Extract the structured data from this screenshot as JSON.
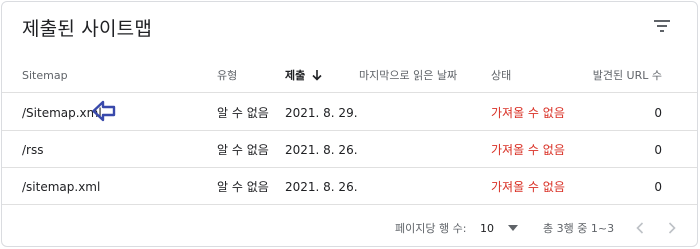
{
  "card": {
    "title": "제출된 사이트맵"
  },
  "icons": {
    "filter": "filter-icon",
    "sort": "arrow-down-icon",
    "annotation": "left-arrow-annotation-icon",
    "page_size_dropdown": "triangle-down-icon",
    "prev": "chevron-left-icon",
    "next": "chevron-right-icon"
  },
  "colors": {
    "error": "#d93025",
    "annotation": "#3949ab",
    "border": "#e0e0e0"
  },
  "table": {
    "headers": {
      "sitemap": "Sitemap",
      "type": "유형",
      "submitted": "제출",
      "last_read": "마지막으로 읽은 날짜",
      "status": "상태",
      "discovered_urls": "발견된 URL 수"
    },
    "rows": [
      {
        "sitemap": "/Sitemap.xml",
        "type": "알 수 없음",
        "submitted": "2021. 8. 29.",
        "last_read": "",
        "status": "가져올 수 없음",
        "discovered_urls": "0"
      },
      {
        "sitemap": "/rss",
        "type": "알 수 없음",
        "submitted": "2021. 8. 26.",
        "last_read": "",
        "status": "가져올 수 없음",
        "discovered_urls": "0"
      },
      {
        "sitemap": "/sitemap.xml",
        "type": "알 수 없음",
        "submitted": "2021. 8. 26.",
        "last_read": "",
        "status": "가져올 수 없음",
        "discovered_urls": "0"
      }
    ]
  },
  "pagination": {
    "rows_per_page_label": "페이지당 행 수:",
    "rows_per_page_value": "10",
    "range_text": "총 3행 중 1~3"
  }
}
